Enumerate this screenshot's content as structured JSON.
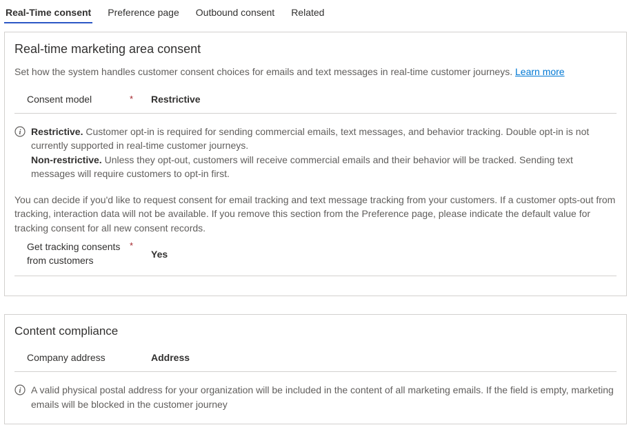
{
  "tabs": {
    "realtime": "Real-Time consent",
    "preference": "Preference page",
    "outbound": "Outbound consent",
    "related": "Related"
  },
  "section1": {
    "title": "Real-time marketing area consent",
    "desc": "Set how the system handles customer consent choices for emails and text messages in real-time customer journeys. ",
    "learn_more": "Learn more",
    "field1": {
      "label": "Consent model",
      "value": "Restrictive"
    },
    "info": {
      "restrictive_label": "Restrictive.",
      "restrictive_text": " Customer opt-in is required for sending commercial emails, text messages, and behavior tracking. Double opt-in is not currently supported in real-time customer journeys.",
      "nonrestrictive_label": "Non-restrictive.",
      "nonrestrictive_text": " Unless they opt-out, customers will receive commercial emails and their behavior will be tracked. Sending text messages will require customers to opt-in first."
    },
    "body2": "You can decide if you'd like to request consent for email tracking and text message tracking from your customers. If a customer opts-out from tracking, interaction data will not be available. If you remove this section from the Preference page, please indicate the default value for tracking consent for all new consent records.",
    "field2": {
      "label": "Get tracking consents from customers",
      "value": "Yes"
    }
  },
  "section2": {
    "title": "Content compliance",
    "field1": {
      "label": "Company address",
      "value": "Address"
    },
    "info": "A valid physical postal address for your organization will be included in the content of all marketing emails. If the field is empty, marketing emails will be blocked in the customer journey"
  }
}
